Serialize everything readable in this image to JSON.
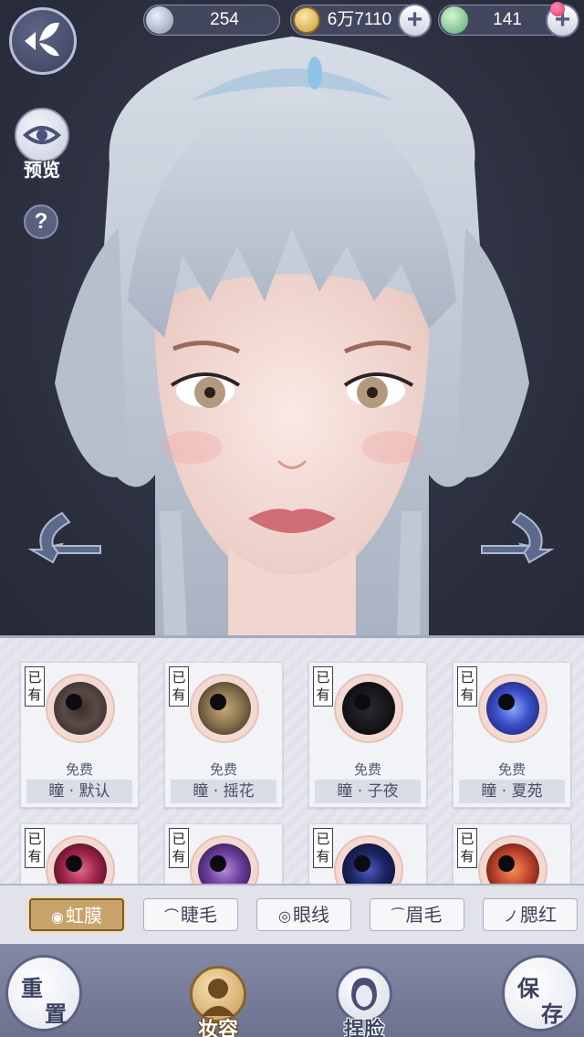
{
  "currencies": [
    {
      "value": "254",
      "icon": "silver-coin-icon"
    },
    {
      "value": "6万7110",
      "icon": "copper-coin-icon"
    },
    {
      "value": "141",
      "icon": "jade-icon"
    }
  ],
  "left_controls": {
    "preview_label": "预览",
    "help_label": "?"
  },
  "items": [
    {
      "owned": "已有",
      "price": "免费",
      "name": "瞳 · 默认",
      "color": "#5a4a46"
    },
    {
      "owned": "已有",
      "price": "免费",
      "name": "瞳 · 摇花",
      "color": "#8a7552"
    },
    {
      "owned": "已有",
      "price": "免费",
      "name": "瞳 · 子夜",
      "color": "#141418"
    },
    {
      "owned": "已有",
      "price": "免费",
      "name": "瞳 · 夏苑",
      "color": "#3b4fc8"
    },
    {
      "owned": "已有",
      "color": "#a0234a"
    },
    {
      "owned": "已有",
      "color": "#6c3f9c"
    },
    {
      "owned": "已有",
      "color": "#1d2564"
    },
    {
      "owned": "已有",
      "color": "#c4462e"
    }
  ],
  "tabs": [
    {
      "label": "虹膜",
      "icon": "◉",
      "active": true
    },
    {
      "label": "睫毛",
      "icon": "⌒",
      "active": false
    },
    {
      "label": "眼线",
      "icon": "◎",
      "active": false
    },
    {
      "label": "眉毛",
      "icon": "⁀",
      "active": false
    },
    {
      "label": "腮红",
      "icon": "ノ",
      "active": false
    }
  ],
  "bottom": {
    "reset": [
      "重",
      "置"
    ],
    "save": [
      "保",
      "存"
    ],
    "makeup": "妆容",
    "face": "捏脸"
  },
  "colors": {
    "accent_gold": "#c9a46a",
    "panel_bg": "#e3e4ec",
    "bottom_bar": "#7a809c"
  }
}
